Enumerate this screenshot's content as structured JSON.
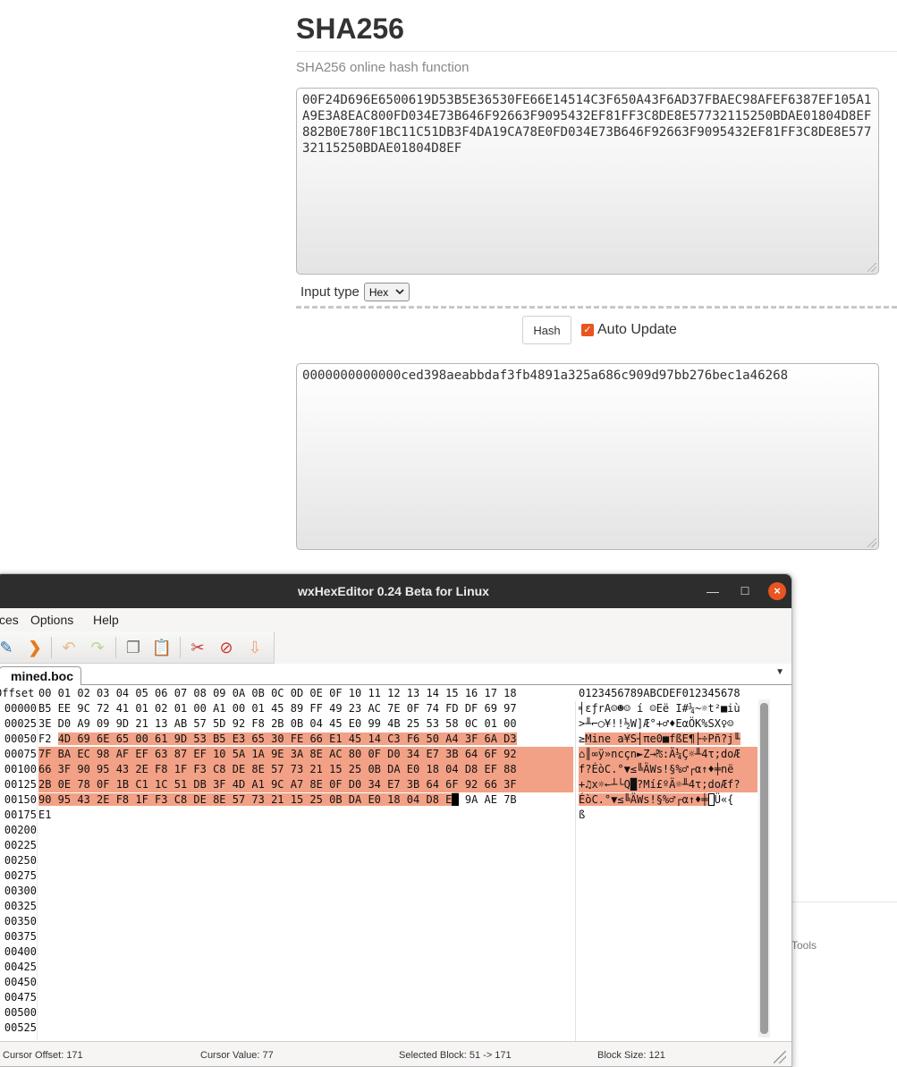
{
  "web": {
    "title": "SHA256",
    "subtitle": "SHA256 online hash function",
    "input_text": "00F24D696E6500619D53B5E36530FE66E14514C3F650A43F6AD37FBAEC98AFEF6387EF105A1A9E3A8EAC800FD034E73B646F92663F9095432EF81FF3C8DE8E57732115250BDAE01804D8EF882B0E780F1BC11C51DB3F4DA19CA78E0FD034E73B646F92663F9095432EF81FF3C8DE8E57732115250BDAE01804D8EF",
    "input_type_label": "Input type",
    "input_type_value": "Hex",
    "hash_button": "Hash",
    "auto_update_label": "Auto Update",
    "output_text": "0000000000000ced398aeabbdaf3fb4891a325a686c909d97bb276bec1a46268",
    "footer_text": "Tools"
  },
  "hexeditor": {
    "window_title": "wxHexEditor 0.24 Beta for Linux",
    "menu": [
      "ces",
      "Options",
      "Help"
    ],
    "tab": "mined.boc",
    "offset_header": "Offset",
    "hex_header": [
      "00",
      "01",
      "02",
      "03",
      "04",
      "05",
      "06",
      "07",
      "08",
      "09",
      "0A",
      "0B",
      "0C",
      "0D",
      "0E",
      "0F",
      "10",
      "11",
      "12",
      "13",
      "14",
      "15",
      "16",
      "17",
      "18"
    ],
    "ascii_header": "0123456789ABCDEF012345678",
    "offsets": [
      "00000",
      "00025",
      "00050",
      "00075",
      "00100",
      "00125",
      "00150",
      "00175",
      "00200",
      "00225",
      "00250",
      "00275",
      "00300",
      "00325",
      "00350",
      "00375",
      "00400",
      "00425",
      "00450",
      "00475",
      "00500",
      "00525"
    ],
    "hex_rows": [
      "B5 EE 9C 72 41 01 02 01 00 A1 00 01 45 89 FF 49 23 AC 7E 0F 74 FD DF 69 97",
      "3E D0 A9 09 9D 21 13 AB 57 5D 92 F8 2B 0B 04 45 E0 99 4B 25 53 58 0C 01 00",
      "F2 4D 69 6E 65 00 61 9D 53 B5 E3 65 30 FE 66 E1 45 14 C3 F6 50 A4 3F 6A D3",
      "7F BA EC 98 AF EF 63 87 EF 10 5A 1A 9E 3A 8E AC 80 0F D0 34 E7 3B 64 6F 92",
      "66 3F 90 95 43 2E F8 1F F3 C8 DE 8E 57 73 21 15 25 0B DA E0 18 04 D8 EF 88",
      "2B 0E 78 0F 1B C1 1C 51 DB 3F 4D A1 9C A7 8E 0F D0 34 E7 3B 64 6F 92 66 3F",
      "90 95 43 2E F8 1F F3 C8 DE 8E 57 73 21 15 25 0B DA E0 18 04 D8 E",
      "E1"
    ],
    "hex_row6_tail": "9A AE 7B",
    "ascii_rows": [
      "╡εƒrA☺☻☺ í ☺Eë I#¼~☼t²■iù",
      ">╨⌐○¥!!½W]Æ°+♂♦EαÖK%SX♀☺",
      "≥Mine a¥S┤πe0■fßE¶├÷Pñ?j╙",
      "⌂║∞ÿ»ncçn►Z→₧:Ä¼Ç☼╨4τ;doÆ",
      "f?ÉòC.°▼≤╚ÄWs!§%♂┌α↑♦╪në",
      "+♫x☼←┴└Q█?Mí£ºÄ☼╨4τ;doÆf?",
      "ÉòC.°▼≤╚ÄWs!§%♂┌α↑♦╪",
      "ß"
    ],
    "ascii_row6_tail": "Ü«{",
    "status": {
      "cursor_offset": "Cursor Offset: 171",
      "cursor_value": "Cursor Value: 77",
      "selected_block": "Selected Block: 51 -> 171",
      "block_size": "Block Size: 121"
    }
  }
}
